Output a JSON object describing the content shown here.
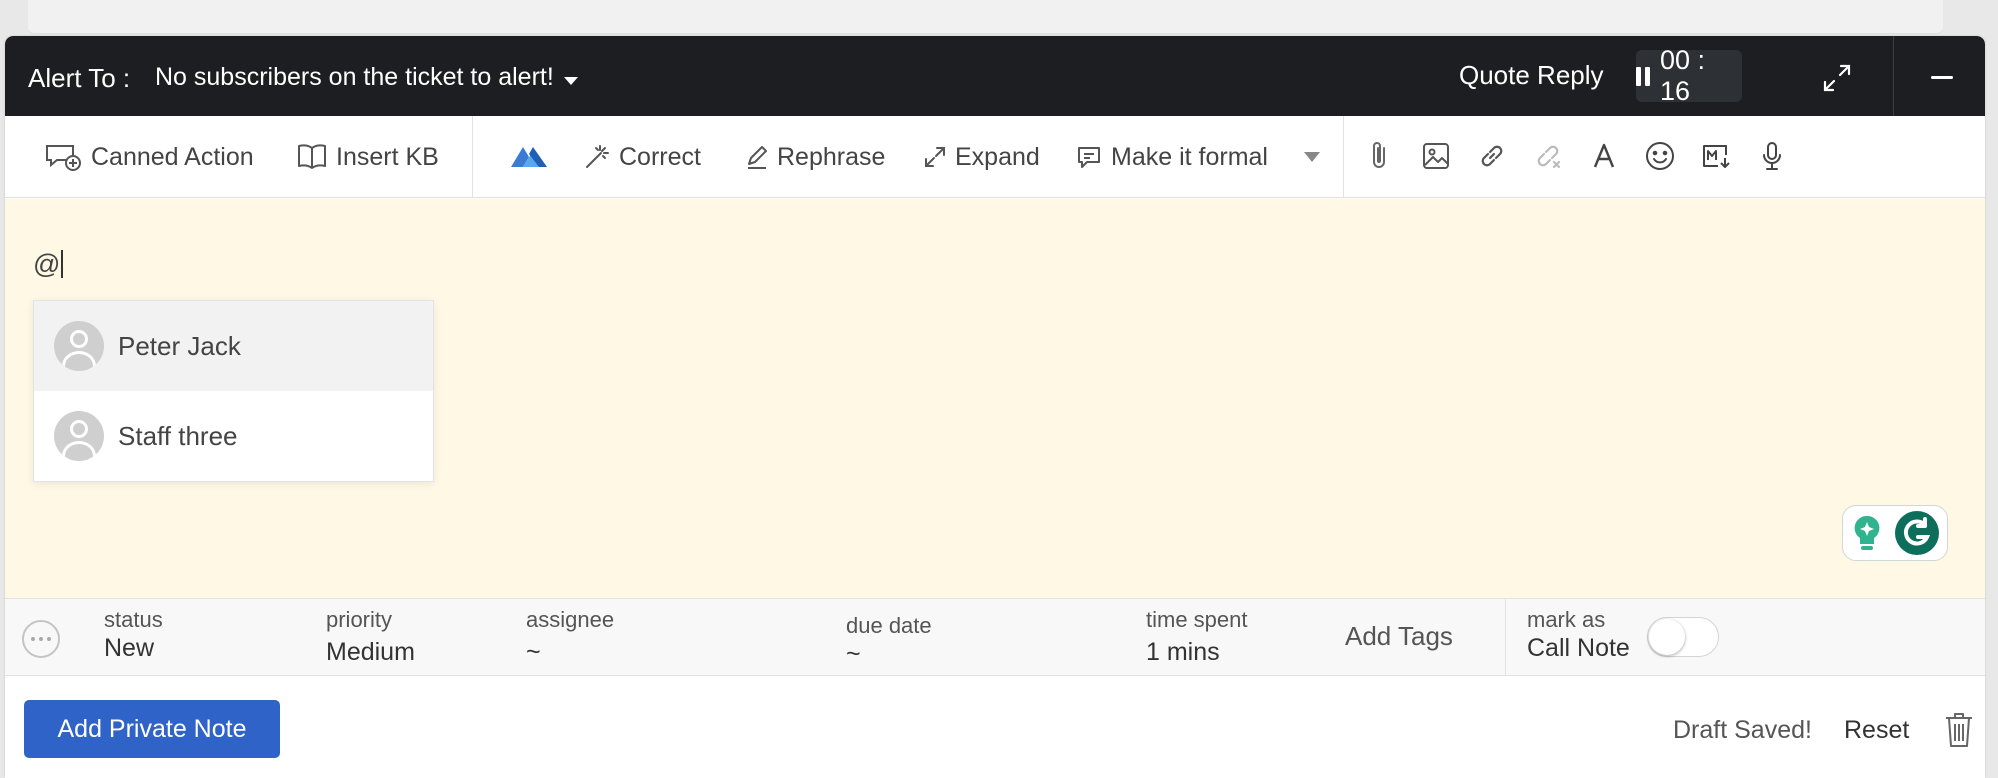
{
  "header": {
    "alert_label": "Alert To :",
    "alert_value": "No subscribers on the ticket to alert!",
    "quote_reply": "Quote Reply",
    "timer": "00 : 16"
  },
  "toolbar": {
    "canned_action": "Canned Action",
    "insert_kb": "Insert KB",
    "correct": "Correct",
    "rephrase": "Rephrase",
    "expand": "Expand",
    "make_formal": "Make it formal"
  },
  "editor": {
    "text": "@",
    "mentions": [
      {
        "name": "Peter Jack"
      },
      {
        "name": "Staff three"
      }
    ]
  },
  "meta": {
    "status": {
      "label": "status",
      "value": "New"
    },
    "priority": {
      "label": "priority",
      "value": "Medium"
    },
    "assignee": {
      "label": "assignee",
      "value": "~"
    },
    "due_date": {
      "label": "due date",
      "value": "~"
    },
    "time_spent": {
      "label": "time spent",
      "value": "1 mins"
    },
    "add_tags": "Add Tags",
    "mark_as": {
      "label": "mark as",
      "value": "Call Note",
      "enabled": false
    }
  },
  "footer": {
    "primary_button": "Add Private Note",
    "draft_status": "Draft Saved!",
    "reset": "Reset"
  },
  "colors": {
    "header_bg": "#1c1e21",
    "editor_bg": "#fef8e5",
    "primary": "#2f63c7",
    "grammarly": "#15c39a"
  },
  "icons": [
    "canned-action-icon",
    "book-icon",
    "ai-logo-icon",
    "magic-wand-icon",
    "pencil-icon",
    "expand-arrows-icon",
    "speech-bubble-icon",
    "chevron-down-icon",
    "paperclip-icon",
    "image-icon",
    "link-icon",
    "unlink-icon",
    "font-icon",
    "emoji-icon",
    "markdown-icon",
    "microphone-icon",
    "fullscreen-icon",
    "minimize-icon",
    "pause-icon",
    "more-icon",
    "trash-icon",
    "grammarly-icon"
  ]
}
